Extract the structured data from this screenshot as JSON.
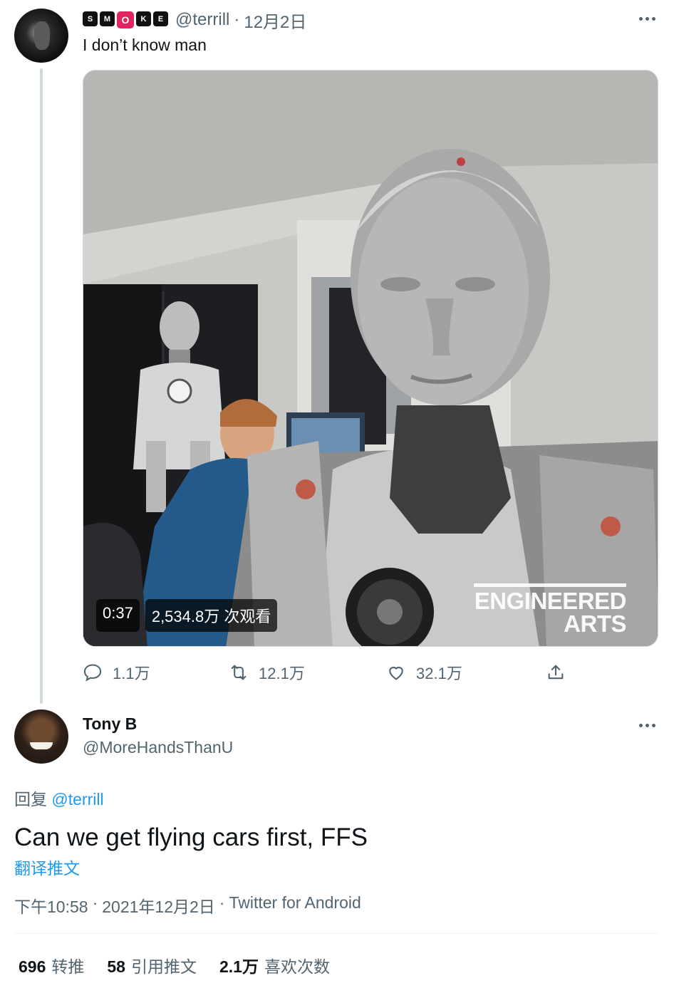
{
  "parent": {
    "logo_letters": [
      "S",
      "M",
      "O",
      "K",
      "E"
    ],
    "handle": "@terrill",
    "separator": "·",
    "date": "12月2日",
    "text": "I don’t know man",
    "video": {
      "duration": "0:37",
      "views": "2,534.8万 次观看",
      "watermark_line1": "ENGINEERED",
      "watermark_line2": "ARTS"
    },
    "actions": {
      "replies": "1.1万",
      "retweets": "12.1万",
      "likes": "32.1万"
    }
  },
  "reply": {
    "name": "Tony B",
    "handle": "@MoreHandsThanU",
    "replying_label": "回复",
    "replying_to": "@terrill",
    "text": "Can we get flying cars first, FFS",
    "translate": "翻译推文",
    "time": "下午10:58",
    "dot1": "·",
    "date": "2021年12月2日",
    "dot2": "·",
    "source": "Twitter for Android"
  },
  "stats": {
    "retweets_count": "696",
    "retweets_label": "转推",
    "quotes_count": "58",
    "quotes_label": "引用推文",
    "likes_count": "2.1万",
    "likes_label": "喜欢次数"
  },
  "colors": {
    "accent": "#1d9bf0",
    "secondary_text": "#536471",
    "primary_text": "#0f1419"
  }
}
